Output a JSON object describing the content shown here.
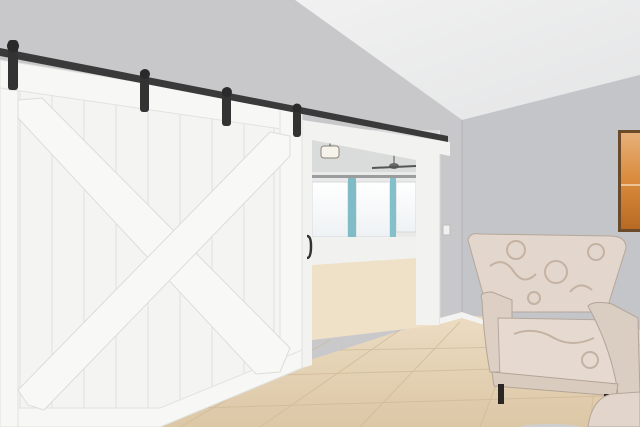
{
  "scene": {
    "watermark": "",
    "colors": {
      "wall_left": "#c7c7c9",
      "wall_right": "#c2c3c6",
      "ceiling": "#eceded",
      "barn_door": "#f4f4f2",
      "rail": "#3a3a3a",
      "tile": "#e2cfb2",
      "curtain": "#7fbcc7",
      "chair_fabric": "#e3d6cc",
      "chair_pattern": "#c8b8aa",
      "art_orange": "#d98a3a"
    }
  }
}
